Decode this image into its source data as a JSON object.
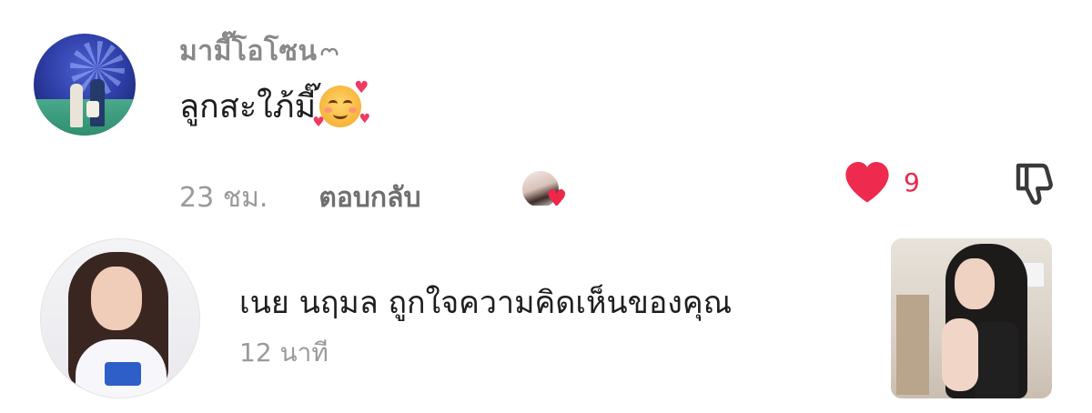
{
  "comment": {
    "username": "มามี๊โอโซน",
    "username_suffix_icon": "small-heart-outline-icon",
    "text": "ลูกสะใภ้มี๊",
    "emoji": "smiling-face-with-hearts-emoji",
    "time": "23 ชม.",
    "reply_label": "ตอบกลับ",
    "like_count": "9",
    "colors": {
      "like_red": "#e8284f",
      "username_gray": "#888888",
      "meta_gray": "#9a9a9a"
    }
  },
  "notification": {
    "text": "เนย นฤมล ถูกใจความคิดเห็นของคุณ",
    "time": "12 นาที"
  }
}
